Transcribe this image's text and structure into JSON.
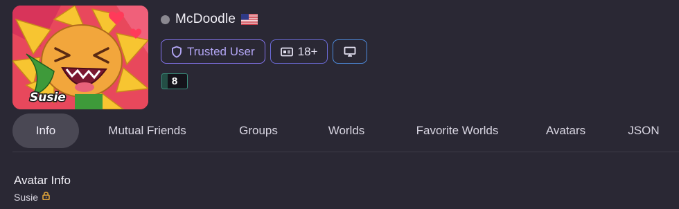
{
  "profile": {
    "username": "McDoodle",
    "avatar_caption": "Susie",
    "status_color": "#8a8890",
    "flag_icon": "us-flag-icon",
    "level": "8"
  },
  "badges": {
    "trusted_label": "Trusted User",
    "age_label": "18+",
    "platform_icon": "monitor-icon"
  },
  "tabs": [
    {
      "label": "Info",
      "active": true
    },
    {
      "label": "Mutual Friends"
    },
    {
      "label": "Groups"
    },
    {
      "label": "Worlds"
    },
    {
      "label": "Favorite Worlds"
    },
    {
      "label": "Avatars"
    },
    {
      "label": "JSON"
    }
  ],
  "info": {
    "section_title": "Avatar Info",
    "avatar_name": "Susie",
    "lock_icon": "lock-icon"
  },
  "colors": {
    "accent": "#8474ee",
    "platform_border": "#4e8de0",
    "lock": "#e0a43a"
  }
}
